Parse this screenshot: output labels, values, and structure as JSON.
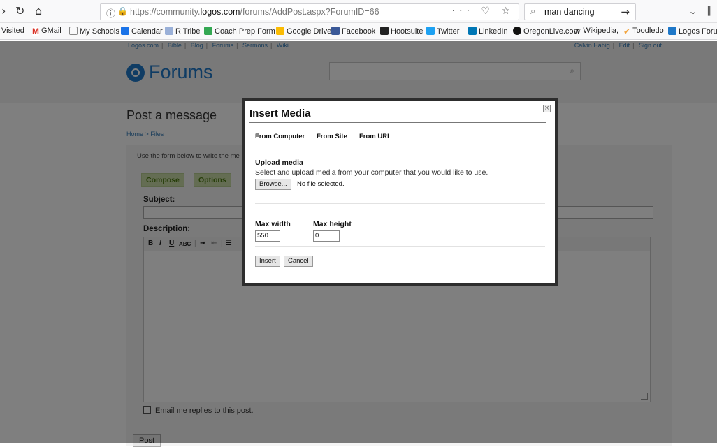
{
  "browser": {
    "url_prefix": "https://community.",
    "url_domain": "logos.com",
    "url_path": "/forums/AddPost.aspx?ForumID=66",
    "url_more": "··· ♡ ☆",
    "search_query": "man dancing"
  },
  "bookmarks": [
    {
      "label": "Visited",
      "color": "#f9f9fa"
    },
    {
      "label": "GMail",
      "color": "#d93025"
    },
    {
      "label": "My Schools",
      "color": "#888888"
    },
    {
      "label": "Calendar",
      "color": "#1a73e8"
    },
    {
      "label": "R|Tribe",
      "color": "#9ab0d8"
    },
    {
      "label": "Coach Prep Form",
      "color": "#34a853"
    },
    {
      "label": "Google Drive",
      "color": "#fbbc04"
    },
    {
      "label": "Facebook",
      "color": "#3b5998"
    },
    {
      "label": "Hootsuite",
      "color": "#222222"
    },
    {
      "label": "Twitter",
      "color": "#1da1f2"
    },
    {
      "label": "LinkedIn",
      "color": "#0077b5"
    },
    {
      "label": "OregonLive.com",
      "color": "#111111"
    },
    {
      "label": "Wikipedia,",
      "color": "#ffffff"
    },
    {
      "label": "Toodledo",
      "color": "#f2a33a"
    },
    {
      "label": "Logos Forum",
      "color": "#1f78c8"
    }
  ],
  "site": {
    "top_links": [
      "Logos.com",
      "Bible",
      "Blog",
      "Forums",
      "Sermons",
      "Wiki"
    ],
    "user_links": [
      "Calvin Habig",
      "Edit",
      "Sign out"
    ],
    "logo_text": "Forums"
  },
  "post": {
    "title": "Post a message",
    "breadcrumb": "Home > Files",
    "intro": "Use the form below to write the me",
    "tab_compose": "Compose",
    "tab_options": "Options",
    "subject_label": "Subject:",
    "description_label": "Description:",
    "email_label": "Email me replies to this post.",
    "post_button": "Post"
  },
  "modal": {
    "title": "Insert Media",
    "tabs": [
      "From Computer",
      "From Site",
      "From URL"
    ],
    "upload_title": "Upload media",
    "upload_desc": "Select and upload media from your computer that you would like to use.",
    "browse_label": "Browse...",
    "file_status": "No file selected.",
    "max_width_label": "Max width",
    "max_height_label": "Max height",
    "max_width_value": "550",
    "max_height_value": "0",
    "insert_label": "Insert",
    "cancel_label": "Cancel"
  }
}
